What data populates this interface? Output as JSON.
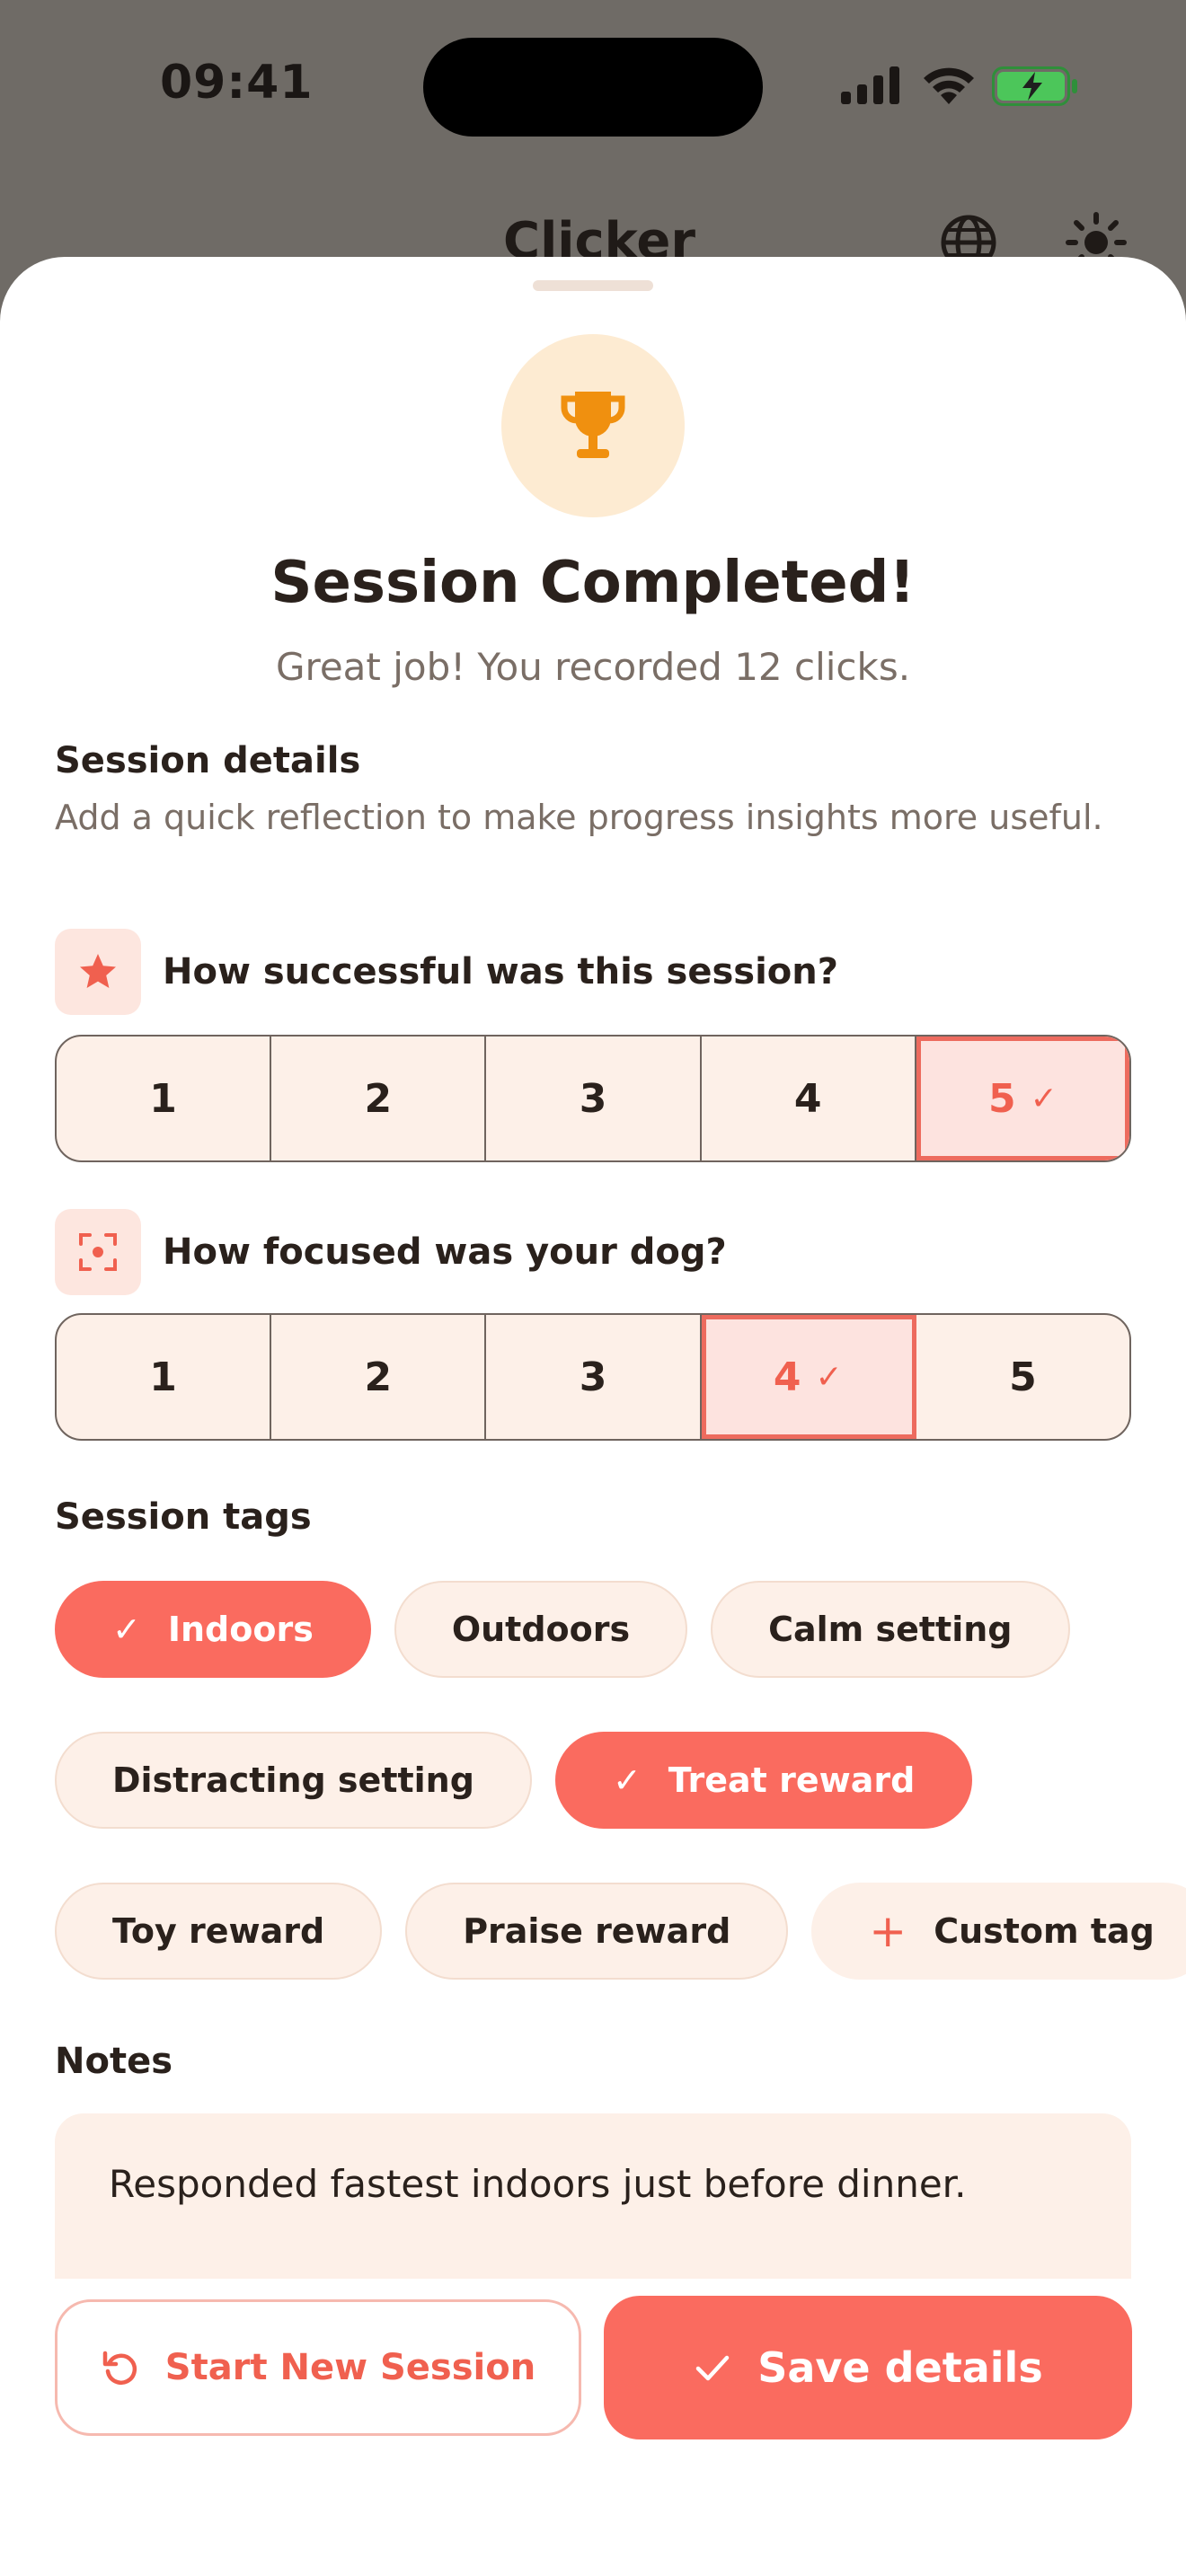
{
  "status_bar": {
    "time": "09:41"
  },
  "app": {
    "title": "Clicker"
  },
  "sheet": {
    "title": "Session Completed!",
    "subtitle": "Great job! You recorded 12 clicks.",
    "details": {
      "heading": "Session details",
      "description": "Add a quick reflection to make progress insights more useful."
    },
    "success": {
      "question": "How successful was this session?",
      "options": [
        "1",
        "2",
        "3",
        "4",
        "5"
      ],
      "selected": "5"
    },
    "focus": {
      "question": "How focused was your dog?",
      "options": [
        "1",
        "2",
        "3",
        "4",
        "5"
      ],
      "selected": "4"
    },
    "tags": {
      "heading": "Session tags",
      "items": [
        {
          "label": "Indoors",
          "selected": true
        },
        {
          "label": "Outdoors",
          "selected": false
        },
        {
          "label": "Calm setting",
          "selected": false
        },
        {
          "label": "Distracting setting",
          "selected": false
        },
        {
          "label": "Treat reward",
          "selected": true
        },
        {
          "label": "Toy reward",
          "selected": false
        },
        {
          "label": "Praise reward",
          "selected": false
        }
      ],
      "custom_label": "Custom tag"
    },
    "notes": {
      "heading": "Notes",
      "value": "Responded fastest indoors just before dinner."
    },
    "buttons": {
      "secondary": "Start New Session",
      "primary": "Save details"
    }
  },
  "colors": {
    "accent": "#fa6b5f",
    "chip_bg": "#fdf0e8",
    "trophy": "#f0900f",
    "trophy_bg": "#fdebd2",
    "overlay": "#6f6b66"
  }
}
